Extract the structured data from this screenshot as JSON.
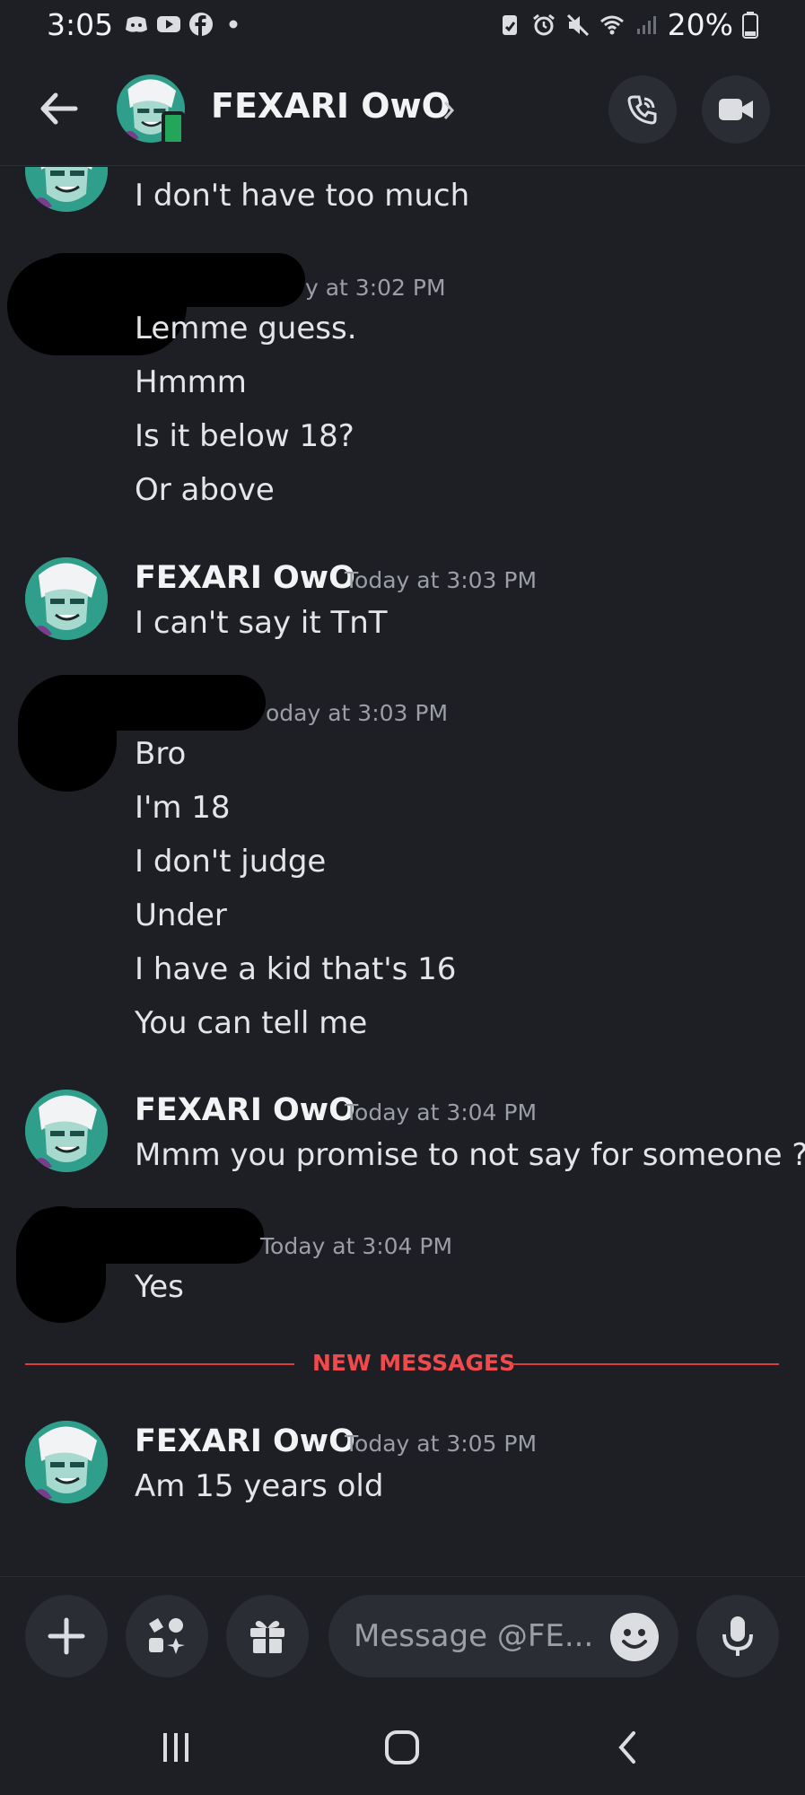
{
  "status_bar": {
    "time": "3:05",
    "battery": "20%"
  },
  "header": {
    "contact_name": "FEXARI OwO"
  },
  "messages": [
    {
      "author": "",
      "timestamp": "",
      "lines": [
        "I don't have too much"
      ]
    },
    {
      "author": "",
      "timestamp": "y at 3:02 PM",
      "lines": [
        "Lemme guess.",
        "Hmmm",
        "Is it below 18?",
        "Or above"
      ]
    },
    {
      "author": "FEXARI OwO",
      "timestamp": "Today at 3:03 PM",
      "lines": [
        "I can't say it TnT"
      ]
    },
    {
      "author": "",
      "timestamp": "oday at 3:03 PM",
      "lines": [
        "Bro",
        "I'm 18",
        "I don't judge",
        "Under",
        "I have a kid that's 16",
        "You can tell me"
      ]
    },
    {
      "author": "FEXARI OwO",
      "timestamp": "Today at 3:04 PM",
      "lines": [
        "Mmm you promise to not say for someone ?"
      ]
    },
    {
      "author": "",
      "timestamp": "Today at 3:04 PM",
      "lines": [
        "Yes"
      ]
    },
    {
      "author": "FEXARI OwO",
      "timestamp": "Today at 3:05 PM",
      "lines": [
        "Am 15 years old"
      ]
    }
  ],
  "divider": {
    "label": "NEW MESSAGES"
  },
  "composer": {
    "placeholder": "Message @FE..."
  },
  "colors": {
    "background": "#1e1f24",
    "divider_red": "#f04a4d",
    "online_green": "#23a55a",
    "avatar_teal": "#2f9e8a"
  }
}
